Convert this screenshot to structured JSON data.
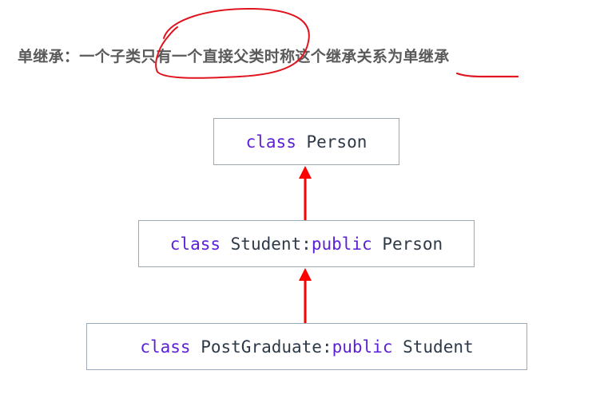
{
  "heading": {
    "text": "单继承：一个子类只有一个直接父类时称这个继承关系为单继承"
  },
  "diagram": {
    "person_box": {
      "keyword": "class",
      "name": "Person"
    },
    "student_box": {
      "keyword": "class",
      "name": "Student",
      "separator": ":",
      "access": "public",
      "base": "Person"
    },
    "postgraduate_box": {
      "keyword": "class",
      "name": "PostGraduate",
      "separator": ":",
      "access": "public",
      "base": "Student"
    }
  },
  "colors": {
    "heading_text": "#5a5a5a",
    "keyword": "#5b1fd6",
    "arrow": "#ff0000",
    "annotation": "#e0141e",
    "box_border": "#9aaab8"
  }
}
